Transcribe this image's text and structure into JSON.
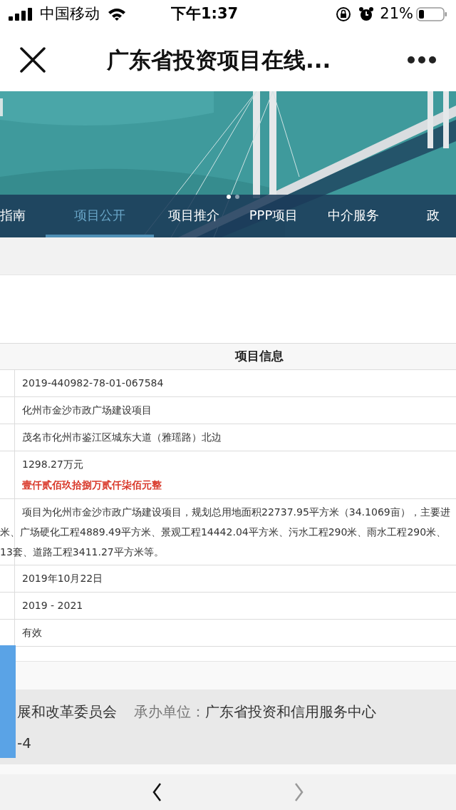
{
  "status_bar": {
    "carrier": "中国移动",
    "time": "下午1:37",
    "battery": "21%"
  },
  "title_bar": {
    "title": "广东省投资项目在线..."
  },
  "banner": {
    "dots": [
      {
        "selected": true
      },
      {
        "selected": false
      }
    ]
  },
  "tabs": [
    {
      "label": "指南",
      "selected": false
    },
    {
      "label": "项目公开",
      "selected": true
    },
    {
      "label": "项目推介",
      "selected": false
    },
    {
      "label": "PPP项目",
      "selected": false
    },
    {
      "label": "中介服务",
      "selected": false
    },
    {
      "label": "政",
      "selected": false
    }
  ],
  "table": {
    "heading": "项目信息",
    "rows": [
      {
        "lines": [
          "2019-440982-78-01-067584"
        ]
      },
      {
        "lines": [
          "化州市金沙市政广场建设项目"
        ]
      },
      {
        "lines": [
          "茂名市化州市鉴江区城东大道（雅瑶路）北边"
        ]
      },
      {
        "lines": [
          "1298.27万元"
        ],
        "note": "壹仟贰佰玖拾捌万贰仟柒佰元整"
      },
      {
        "lines": [
          "项目为化州市金沙市政广场建设项目，规划总用地面积22737.95平方米（34.1069亩），主要进",
          "米、广场硬化工程4889.49平方米、景观工程14442.04平方米、污水工程290米、雨水工程290米、",
          "13套、道路工程3411.27平方米等。"
        ],
        "kind": "wrapped"
      },
      {
        "lines": [
          "2019年10月22日"
        ]
      },
      {
        "lines": [
          "2019 - 2021"
        ]
      },
      {
        "lines": [
          "有效"
        ]
      }
    ]
  },
  "footer": {
    "line_1": "展和改革委员会",
    "label": "承办单位：",
    "organizer": "广东省投资和信用服务中心",
    "line_2": "-4"
  },
  "browser_nav": {
    "back_disabled": false,
    "forward_disabled": true
  }
}
